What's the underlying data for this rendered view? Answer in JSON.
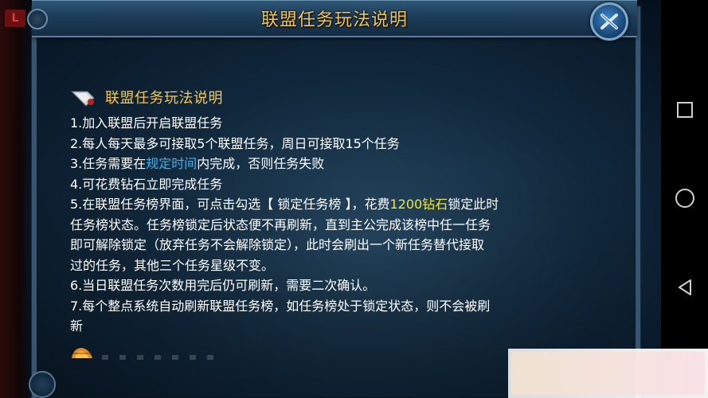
{
  "window": {
    "title": "联盟任务玩法说明",
    "side_tag": "L"
  },
  "section": {
    "title": "联盟任务玩法说明",
    "rules": [
      {
        "id": "r1",
        "parts": [
          {
            "text": "1.加入联盟后开启联盟任务",
            "style": "normal"
          }
        ]
      },
      {
        "id": "r2",
        "parts": [
          {
            "text": "2.每人每天最多可接取5个联盟任务，周日可接取15个任务",
            "style": "normal"
          }
        ]
      },
      {
        "id": "r3",
        "parts": [
          {
            "text": "3.任务需要在",
            "style": "normal"
          },
          {
            "text": "规定时间",
            "style": "blue"
          },
          {
            "text": "内完成，否则任务失败",
            "style": "normal"
          }
        ]
      },
      {
        "id": "r4",
        "parts": [
          {
            "text": "4.可花费钻石立即完成任务",
            "style": "normal"
          }
        ]
      },
      {
        "id": "r5",
        "parts": [
          {
            "text": "5.在联盟任务榜界面，可点击勾选【 锁定任务榜 】，花费",
            "style": "normal"
          },
          {
            "text": "1200钻石",
            "style": "yellow"
          },
          {
            "text": "锁定此时",
            "style": "normal"
          }
        ]
      },
      {
        "id": "r5b",
        "parts": [
          {
            "text": "任务榜状态。任务榜锁定后状态便不再刷新，直到主公完成该榜中任一任务",
            "style": "normal"
          }
        ]
      },
      {
        "id": "r5c",
        "parts": [
          {
            "text": "即可解除锁定（放弃任务不会解除锁定），此时会刷出一个新任务替代接取",
            "style": "normal"
          }
        ]
      },
      {
        "id": "r5d",
        "parts": [
          {
            "text": "过的任务，其他三个任务星级不变。",
            "style": "normal"
          }
        ]
      },
      {
        "id": "r6",
        "parts": [
          {
            "text": "6.当日联盟任务次数用完后仍可刷新，需要二次确认。",
            "style": "normal"
          }
        ]
      },
      {
        "id": "r7",
        "parts": [
          {
            "text": "7.每个整点系统自动刷新联盟任务榜，如任务榜处于锁定状态，则不会被刷",
            "style": "normal"
          }
        ]
      },
      {
        "id": "r7b",
        "parts": [
          {
            "text": "新",
            "style": "normal"
          }
        ]
      }
    ]
  },
  "icons": {
    "close": "close-x-icon",
    "section": "blade-icon",
    "footer": "flame-icon"
  },
  "navbar": {
    "buttons": [
      "recent-apps",
      "home",
      "back"
    ]
  },
  "colors": {
    "title_gold": "#f2c65a",
    "highlight_blue": "#3fb3f2",
    "highlight_yellow": "#f2e53a",
    "body_text": "#ffffff",
    "panel_bg": "#142c44"
  }
}
